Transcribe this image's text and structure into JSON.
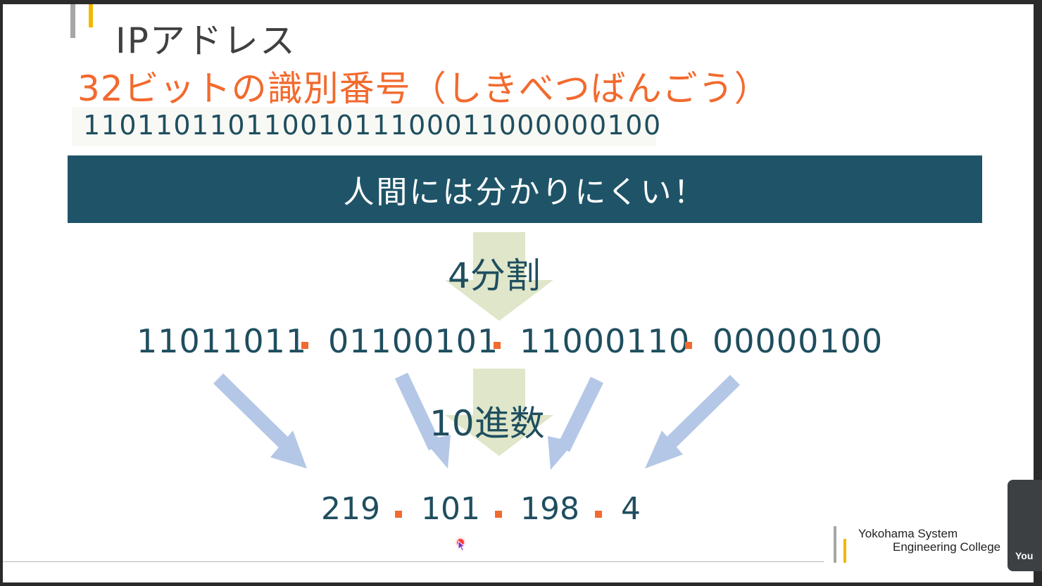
{
  "slide": {
    "title": "IPアドレス",
    "subtitle": "32ビットの識別番号（しきべつばんごう）",
    "binary_full": "11011011011001011100011000000100",
    "banner": "人間には分かりにくい！",
    "step_split": "4分割",
    "step_decimal": "10進数",
    "octets_binary": [
      "11011011",
      "01100101",
      "11000110",
      "00000100"
    ],
    "octets_decimal": [
      "219",
      "101",
      "198",
      "4"
    ],
    "logo": {
      "line1": "Yokohama System",
      "line2": "Engineering College"
    }
  },
  "participant": {
    "label": "You"
  },
  "colors": {
    "title": "#404040",
    "accent_orange": "#f26a2e",
    "teal_text": "#1f4e5f",
    "banner_bg": "#1f5468",
    "arrow_blue": "#b4c7e7",
    "arrow_green": "#dfe6c9",
    "gold": "#f2b800"
  },
  "icons": [
    "mouse-cursor-icon",
    "down-arrow-icon",
    "diagonal-arrow-icon"
  ]
}
